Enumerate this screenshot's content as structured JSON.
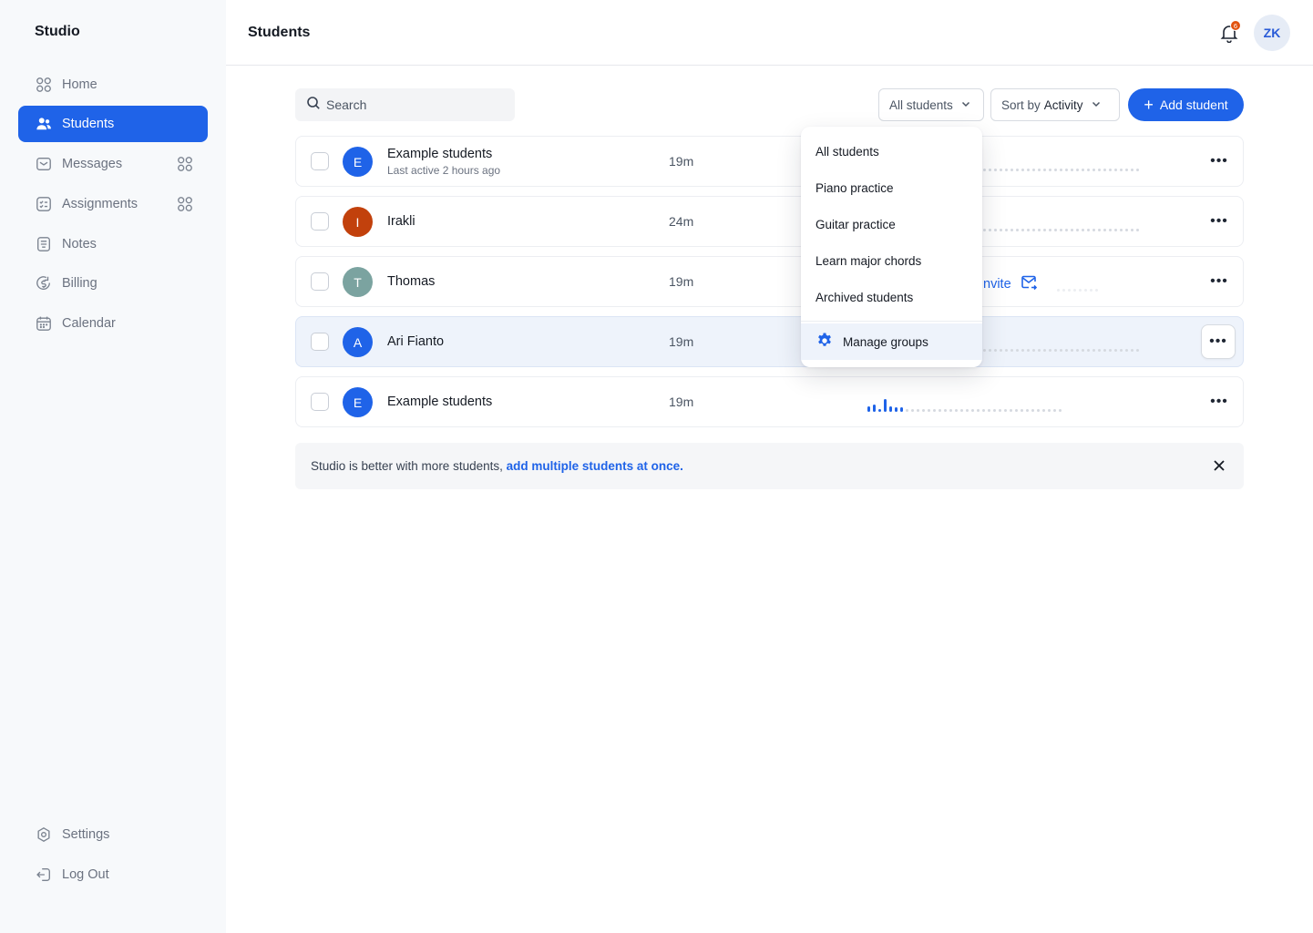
{
  "app": {
    "name": "Studio"
  },
  "sidebar": {
    "items": [
      {
        "label": "Home",
        "icon": "home-grid-icon"
      },
      {
        "label": "Students",
        "icon": "users-icon",
        "active": true
      },
      {
        "label": "Messages",
        "icon": "message-icon"
      },
      {
        "label": "Assignments",
        "icon": "checklist-icon"
      },
      {
        "label": "Notes",
        "icon": "note-icon"
      },
      {
        "label": "Billing",
        "icon": "dollar-icon"
      },
      {
        "label": "Calendar",
        "icon": "calendar-icon"
      }
    ],
    "footer": [
      {
        "label": "Settings",
        "icon": "settings-icon"
      },
      {
        "label": "Log Out",
        "icon": "logout-icon"
      }
    ]
  },
  "header": {
    "title": "Students",
    "notification_count": "6",
    "user_initials": "ZK"
  },
  "toolbar": {
    "search_placeholder": "Search",
    "filter_value": "All students",
    "sort_prefix": "Sort by",
    "sort_value": "Activity",
    "add_label": "Add student"
  },
  "students": [
    {
      "initial": "E",
      "name": "Example students",
      "subtitle": "Last active 2 hours ago",
      "duration": "19m",
      "color": "#1f63e8"
    },
    {
      "initial": "I",
      "name": "Irakli",
      "subtitle": "",
      "duration": "24m",
      "color": "#c2410c"
    },
    {
      "initial": "T",
      "name": "Thomas",
      "subtitle": "",
      "duration": "19m",
      "color": "#7ba3a0",
      "invite_label": "nvite"
    },
    {
      "initial": "A",
      "name": "Ari Fianto",
      "subtitle": "",
      "duration": "19m",
      "color": "#1f63e8",
      "highlighted": true
    },
    {
      "initial": "E",
      "name": "Example students",
      "subtitle": "",
      "duration": "19m",
      "color": "#1f63e8"
    }
  ],
  "group_menu": {
    "items": [
      "All students",
      "Piano practice",
      "Guitar practice",
      "Learn major chords",
      "Archived students"
    ],
    "manage_label": "Manage groups"
  },
  "banner": {
    "text": "Studio is better with more students, ",
    "link": "add multiple students at once."
  },
  "colors": {
    "accent": "#1f63e8",
    "badge": "#e2530f"
  }
}
